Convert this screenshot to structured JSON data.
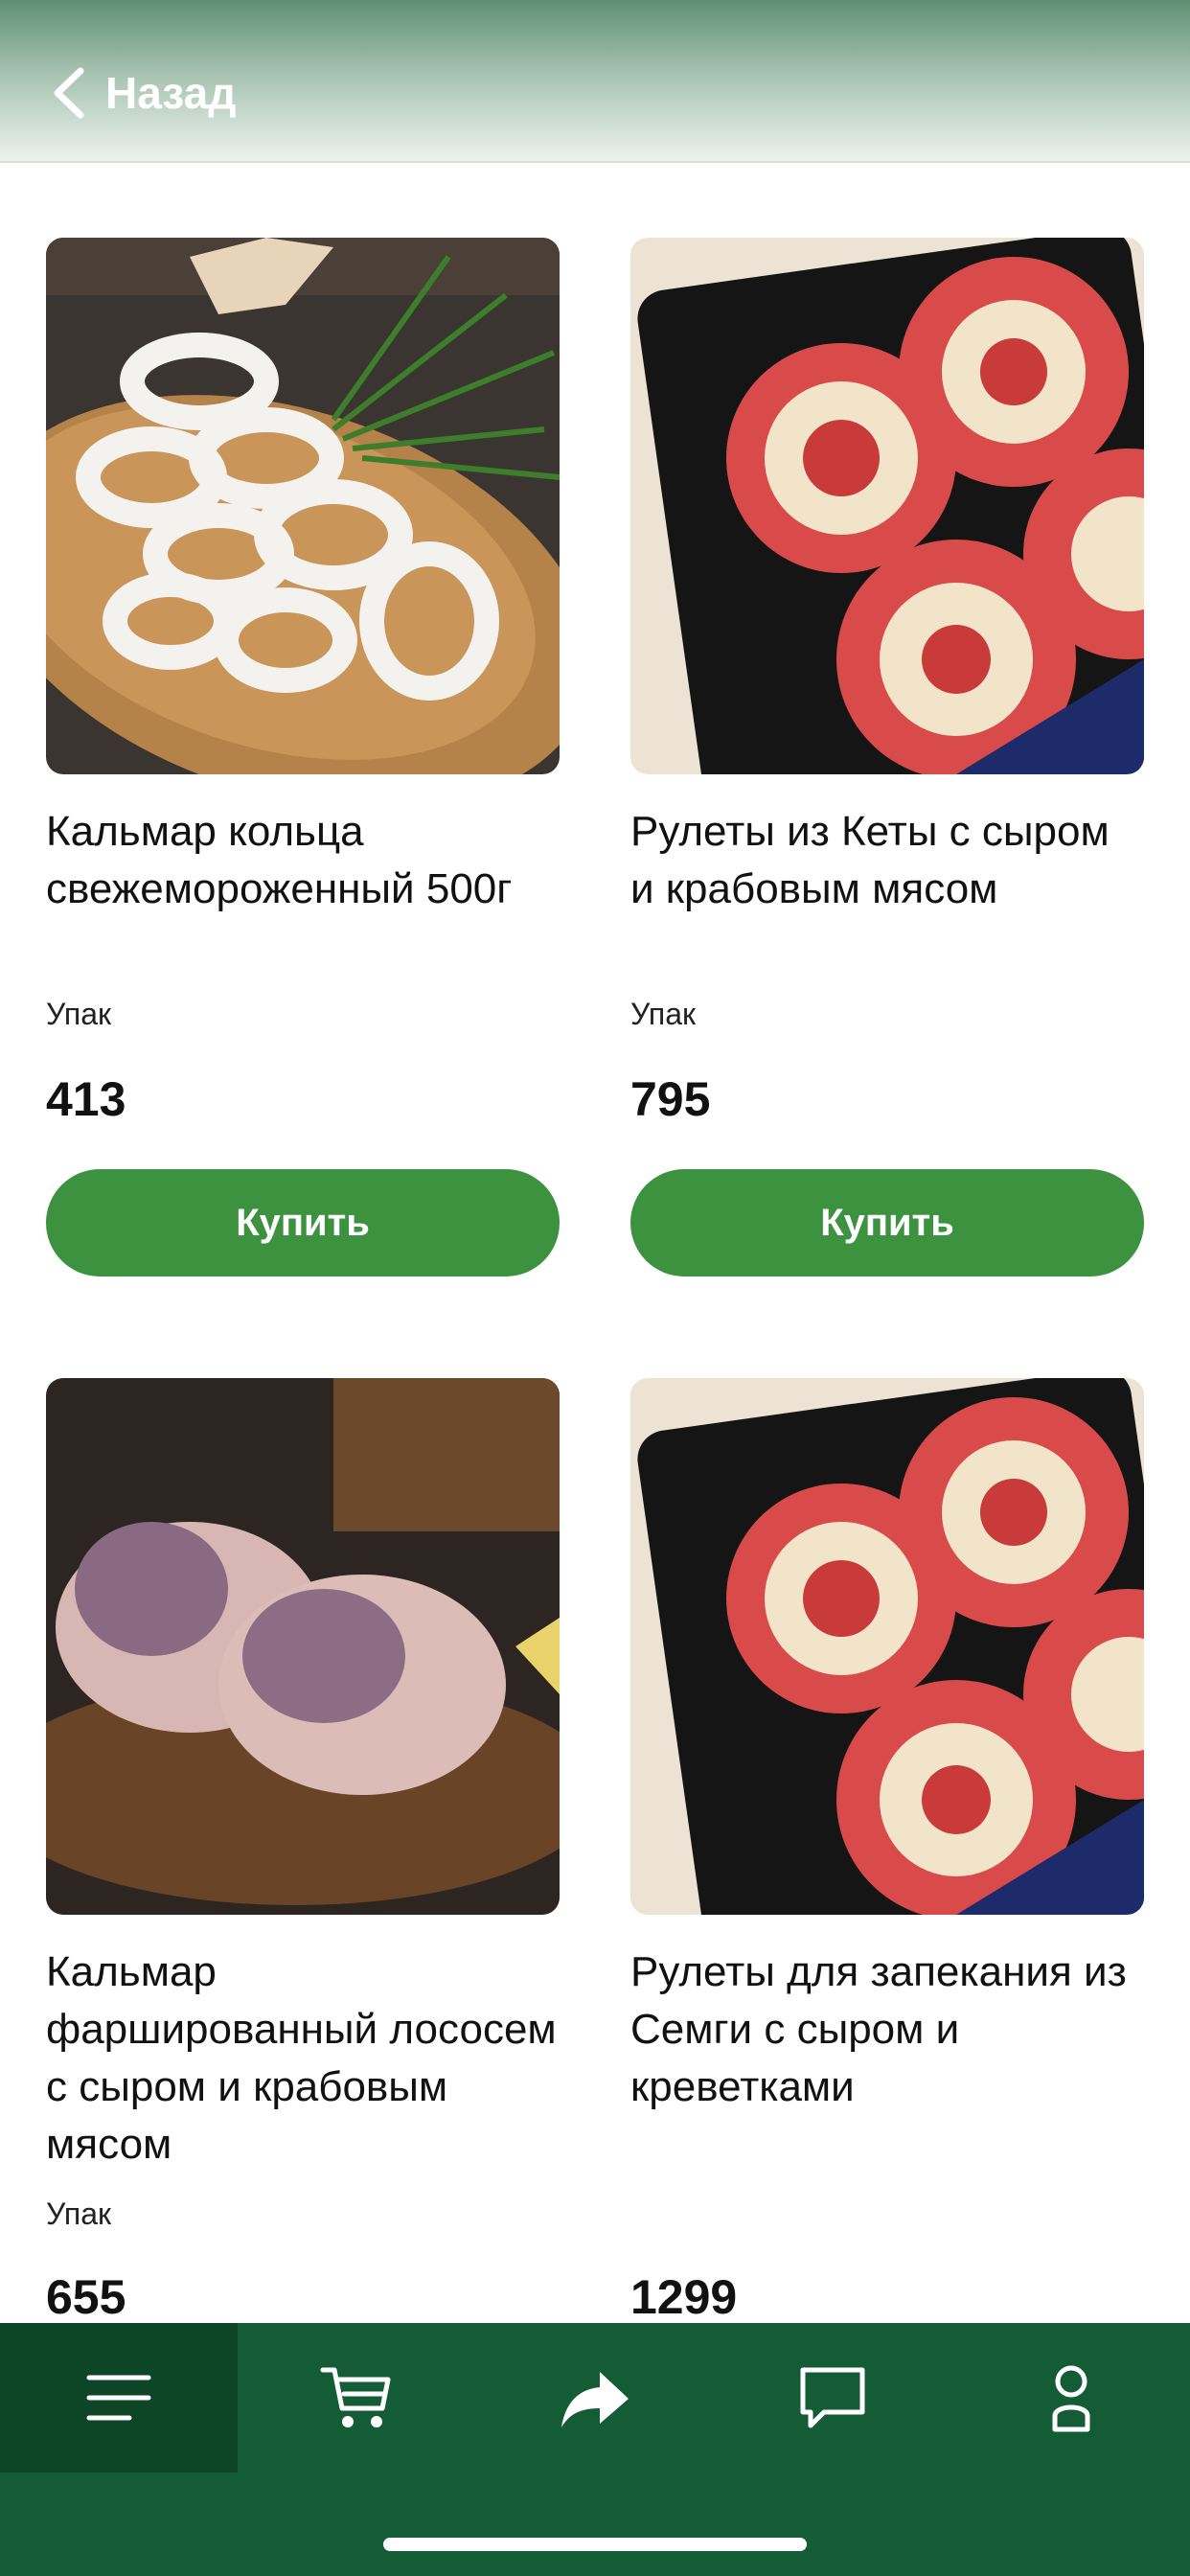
{
  "header": {
    "back_label": "Назад"
  },
  "products": [
    {
      "title": "Кальмар кольца свежемороженный 500г",
      "unit": "Упак",
      "price": "413",
      "buy_label": "Купить"
    },
    {
      "title": "Рулеты из Кеты с сыром и крабовым мясом",
      "unit": "Упак",
      "price": "795",
      "buy_label": "Купить"
    },
    {
      "title": "Кальмар фаршированный лососем с сыром и крабовым мясом",
      "unit": "Упак",
      "price": "655"
    },
    {
      "title": "Рулеты для запекания из Семги с сыром и креветками",
      "unit": "",
      "price": "1299"
    }
  ],
  "tabbar": {
    "items": [
      "menu-icon",
      "cart-icon",
      "share-icon",
      "chat-icon",
      "profile-icon"
    ],
    "colors": {
      "background": "#145c36",
      "active": "#0d4527",
      "buy_button": "#3d9240"
    }
  }
}
